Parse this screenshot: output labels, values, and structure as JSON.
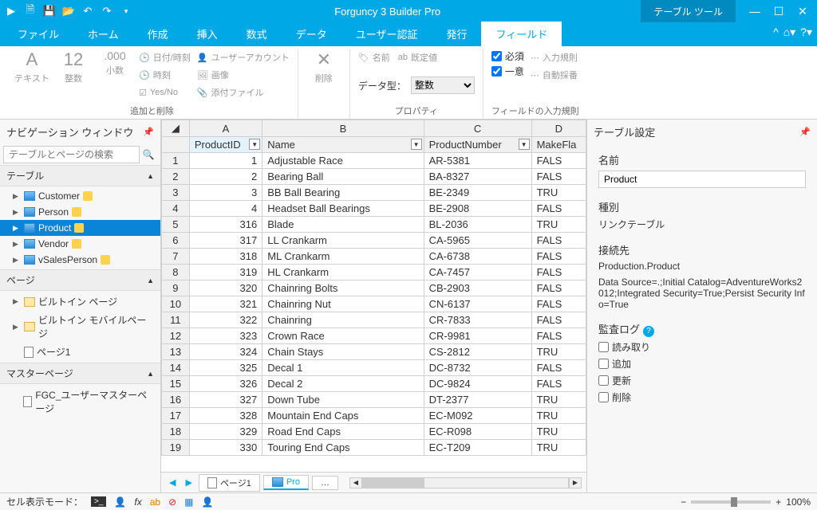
{
  "app_title": "Forguncy 3 Builder Pro",
  "context_tab": "テーブル ツール",
  "tabs": [
    "ファイル",
    "ホーム",
    "作成",
    "挿入",
    "数式",
    "データ",
    "ユーザー認証",
    "発行",
    "フィールド"
  ],
  "active_tab": 8,
  "ribbon": {
    "g1_text": {
      "label": "テキスト"
    },
    "g1_int": {
      "label": "整数"
    },
    "g1_dec": {
      "label": "小数"
    },
    "add_rm": "追加と削除",
    "del": "削除",
    "colA": [
      "日付/時刻",
      "時刻",
      "Yes/No"
    ],
    "colB": [
      "ユーザーアカウント",
      "画像",
      "添付ファイル"
    ],
    "prop_group": "プロパティ",
    "prop_items": [
      "名前",
      "既定値"
    ],
    "datatype_label": "データ型：",
    "datatype_value": "整数",
    "rules_group": "フィールドの入力規則",
    "rules": {
      "required": "必須",
      "unique": "一意",
      "ruleopt": "入力規則",
      "autonum": "自動採番"
    }
  },
  "nav": {
    "title": "ナビゲーション ウィンドウ",
    "search_ph": "テーブルとページの検索",
    "sec_tables": "テーブル",
    "sec_pages": "ページ",
    "sec_master": "マスターページ",
    "tables": [
      "Customer",
      "Person",
      "Product",
      "Vendor",
      "vSalesPerson"
    ],
    "selected_table": 2,
    "page_folders": [
      "ビルトイン ページ",
      "ビルトイン モバイルページ"
    ],
    "pages": [
      "ページ1"
    ],
    "master_pages": [
      "FGC_ユーザーマスターページ"
    ]
  },
  "grid": {
    "col_letters": [
      "A",
      "B",
      "C",
      "D"
    ],
    "headers": [
      "ProductID",
      "Name",
      "ProductNumber",
      "MakeFla"
    ],
    "col_widths": [
      "84px",
      "186px",
      "124px",
      "60px"
    ],
    "rows": [
      [
        "1",
        "Adjustable Race",
        "AR-5381",
        "FALS"
      ],
      [
        "2",
        "Bearing Ball",
        "BA-8327",
        "FALS"
      ],
      [
        "3",
        "BB Ball Bearing",
        "BE-2349",
        "TRU"
      ],
      [
        "4",
        "Headset Ball Bearings",
        "BE-2908",
        "FALS"
      ],
      [
        "316",
        "Blade",
        "BL-2036",
        "TRU"
      ],
      [
        "317",
        "LL Crankarm",
        "CA-5965",
        "FALS"
      ],
      [
        "318",
        "ML Crankarm",
        "CA-6738",
        "FALS"
      ],
      [
        "319",
        "HL Crankarm",
        "CA-7457",
        "FALS"
      ],
      [
        "320",
        "Chainring Bolts",
        "CB-2903",
        "FALS"
      ],
      [
        "321",
        "Chainring Nut",
        "CN-6137",
        "FALS"
      ],
      [
        "322",
        "Chainring",
        "CR-7833",
        "FALS"
      ],
      [
        "323",
        "Crown Race",
        "CR-9981",
        "FALS"
      ],
      [
        "324",
        "Chain Stays",
        "CS-2812",
        "TRU"
      ],
      [
        "325",
        "Decal 1",
        "DC-8732",
        "FALS"
      ],
      [
        "326",
        "Decal 2",
        "DC-9824",
        "FALS"
      ],
      [
        "327",
        "Down Tube",
        "DT-2377",
        "TRU"
      ],
      [
        "328",
        "Mountain End Caps",
        "EC-M092",
        "TRU"
      ],
      [
        "329",
        "Road End Caps",
        "EC-R098",
        "TRU"
      ],
      [
        "330",
        "Touring End Caps",
        "EC-T209",
        "TRU"
      ]
    ]
  },
  "sheets": {
    "page1": "ページ1",
    "product": "Pro",
    "more": "…"
  },
  "props": {
    "title": "テーブル設定",
    "name_label": "名前",
    "name_value": "Product",
    "type_label": "種別",
    "type_value": "リンクテーブル",
    "conn_label": "接続先",
    "conn_value": "Production.Product",
    "conn_str": "Data Source=.;Initial Catalog=AdventureWorks2012;Integrated Security=True;Persist Security Info=True",
    "audit_label": "監査ログ",
    "audit_items": [
      "読み取り",
      "追加",
      "更新",
      "削除"
    ]
  },
  "status": {
    "mode": "セル表示モード：",
    "zoom": "100%"
  }
}
